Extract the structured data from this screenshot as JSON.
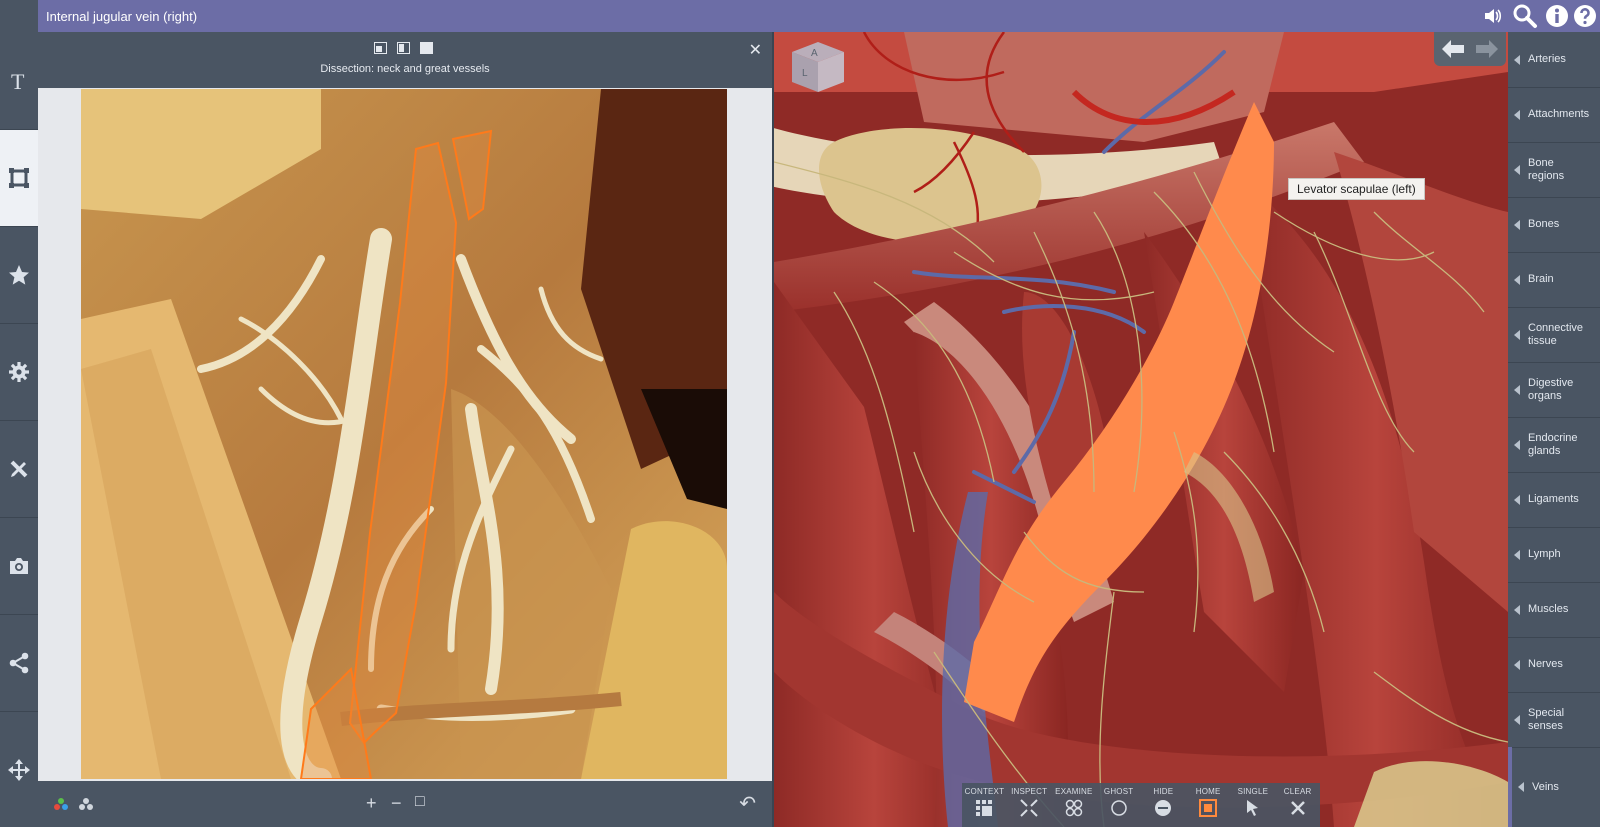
{
  "header": {
    "title": "Internal jugular vein (right)"
  },
  "left_sidebar": {
    "items": [
      {
        "name": "text-icon"
      },
      {
        "name": "crop-icon",
        "active": true
      },
      {
        "name": "star-icon"
      },
      {
        "name": "gear-icon"
      },
      {
        "name": "pencil-ruler-icon"
      },
      {
        "name": "camera-icon"
      },
      {
        "name": "share-icon"
      },
      {
        "name": "move-icon"
      }
    ]
  },
  "panel": {
    "subtitle": "Dissection: neck and great vessels",
    "close_label": "✕",
    "footer": {
      "zoom_in": "+",
      "zoom_out": "−",
      "fit": "□",
      "undo": "↶"
    }
  },
  "viewport": {
    "tooltip": "Levator scapulae (left)",
    "orientation_cube": {
      "top": "A",
      "front": "L"
    },
    "toolbar": [
      {
        "label": "CONTEXT"
      },
      {
        "label": "INSPECT"
      },
      {
        "label": "EXAMINE"
      },
      {
        "label": "GHOST"
      },
      {
        "label": "HIDE"
      },
      {
        "label": "HOME",
        "selected": true
      },
      {
        "label": "SINGLE"
      },
      {
        "label": "CLEAR"
      }
    ]
  },
  "right_sidebar": {
    "items": [
      {
        "label": "Arteries"
      },
      {
        "label": "Attachments"
      },
      {
        "label": "Bone\nregions"
      },
      {
        "label": "Bones"
      },
      {
        "label": "Brain"
      },
      {
        "label": "Connective\ntissue"
      },
      {
        "label": "Digestive\norgans"
      },
      {
        "label": "Endocrine\nglands"
      },
      {
        "label": "Ligaments"
      },
      {
        "label": "Lymph"
      },
      {
        "label": "Muscles"
      },
      {
        "label": "Nerves"
      },
      {
        "label": "Special\nsenses"
      },
      {
        "label": "Veins",
        "active": true
      }
    ]
  },
  "colors": {
    "accent": "#6c6da6",
    "panel": "#4a5563",
    "highlight": "#ff8a3d"
  }
}
